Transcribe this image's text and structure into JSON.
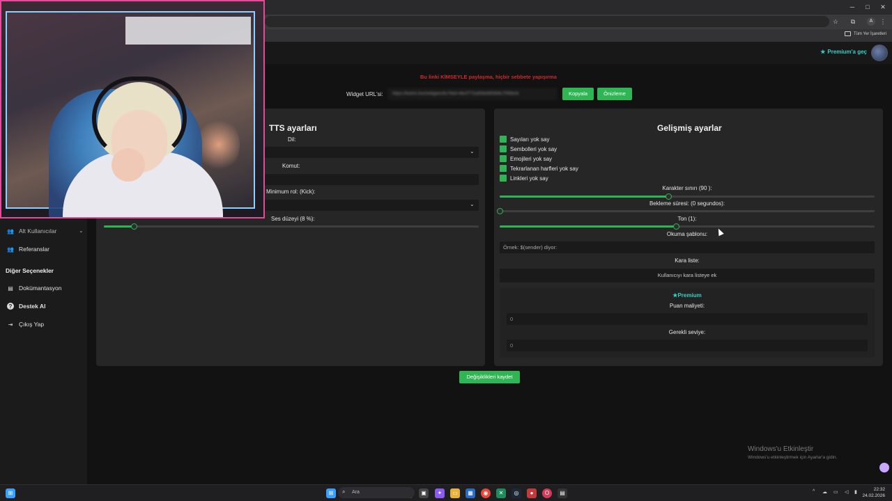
{
  "browser": {
    "bookmarks_label": "Tüm Yer İşaretleri",
    "window_controls": [
      "─",
      "□",
      "✕"
    ],
    "profile_initial": "A"
  },
  "header": {
    "premium_link": "Premium'a geç"
  },
  "sidebar": {
    "items_top": [
      {
        "label": "Alt Kullanıcılar",
        "icon": "users-icon",
        "expandable": true
      },
      {
        "label": "Referanslar",
        "icon": "referrals-icon"
      }
    ],
    "section_heading": "Diğer Seçenekler",
    "items_bottom": [
      {
        "label": "Dokümantasyon",
        "icon": "documentation-icon"
      },
      {
        "label": "Destek Al",
        "icon": "help-icon"
      },
      {
        "label": "Çıkış Yap",
        "icon": "logout-icon"
      }
    ]
  },
  "widget": {
    "warning": "Bu linki KİMSEYLE paylaşma, hiçbir sebbete yapışırma",
    "url_label": "Widget URL'si:",
    "url_value": "https://botrix.live/widgets/tts?bid=4bcf772a5fdefd5569c7f45bcb",
    "copy_button": "Kopyala",
    "preview_button": "Önizleme"
  },
  "tts_panel": {
    "title": "TTS ayarları",
    "language_label": "Dil:",
    "command_label": "Komut:",
    "min_role_label": "Minimum rol: (Kick):",
    "volume_label": "Ses düzeyi (8 %):",
    "volume_value": 8
  },
  "advanced_panel": {
    "title": "Gelişmiş ayarlar",
    "checkboxes": [
      {
        "label": "Sayıları yok say",
        "checked": true
      },
      {
        "label": "Sembolleri yok say",
        "checked": true
      },
      {
        "label": "Emojileri yok say",
        "checked": true
      },
      {
        "label": "Tekrarlanan harfleri yok say",
        "checked": true
      },
      {
        "label": "Linkleri yok say",
        "checked": true
      }
    ],
    "char_limit_label": "Karakter sınırı (90 ):",
    "char_limit_value": 90,
    "char_limit_max": 200,
    "cooldown_label": "Bekleme süresi: (0 segundos):",
    "cooldown_value": 0,
    "tone_label": "Ton (1):",
    "tone_fraction": 0.47,
    "template_label": "Okuma şablonu:",
    "template_placeholder": "Örnek: $(sender) diyor:",
    "blacklist_label": "Kara liste:",
    "blacklist_button": "Kullanıcıyı kara listeye ek",
    "premium_title": "Premium",
    "points_cost_label": "Puan maliyeti:",
    "points_cost_value": "0",
    "required_level_label": "Gerekli seviye:",
    "required_level_value": "0"
  },
  "save_button": "Değişiklikleri kaydet",
  "windows_watermark": {
    "title": "Windows'u Etkinleştir",
    "subtitle": "Windows'u etkinleştirmek için Ayarlar'a gidin."
  },
  "taskbar": {
    "search_placeholder": "Ara",
    "time": "22:32",
    "date": "24.02.2026",
    "accent": "#2fb554"
  }
}
